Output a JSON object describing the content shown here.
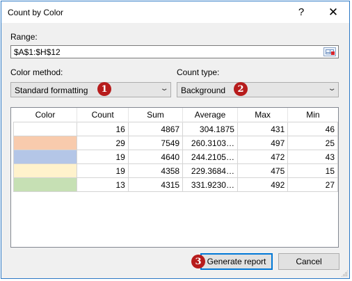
{
  "window": {
    "title": "Count by Color",
    "help_glyph": "?",
    "close_glyph": "✕"
  },
  "range": {
    "label": "Range:",
    "value": "$A$1:$H$12",
    "picker_icon": "range-select-icon"
  },
  "color_method": {
    "label": "Color method:",
    "selected": "Standard formatting",
    "badge": "1"
  },
  "count_type": {
    "label": "Count type:",
    "selected": "Background",
    "badge": "2"
  },
  "table": {
    "columns": [
      "Color",
      "Count",
      "Sum",
      "Average",
      "Max",
      "Min"
    ],
    "rows": [
      {
        "color": "#ffffff",
        "count": "16",
        "sum": "4867",
        "average": "304.1875",
        "max": "431",
        "min": "46"
      },
      {
        "color": "#f8cbad",
        "count": "29",
        "sum": "7549",
        "average": "260.3103…",
        "max": "497",
        "min": "25"
      },
      {
        "color": "#b4c6e7",
        "count": "19",
        "sum": "4640",
        "average": "244.2105…",
        "max": "472",
        "min": "43"
      },
      {
        "color": "#fff2cc",
        "count": "19",
        "sum": "4358",
        "average": "229.3684…",
        "max": "475",
        "min": "15"
      },
      {
        "color": "#c6e0b4",
        "count": "13",
        "sum": "4315",
        "average": "331.9230…",
        "max": "492",
        "min": "27"
      }
    ]
  },
  "buttons": {
    "generate_report": "Generate report",
    "generate_badge": "3",
    "cancel": "Cancel"
  },
  "colors": {
    "badge": "#b71c1c",
    "accent": "#0078d7"
  }
}
